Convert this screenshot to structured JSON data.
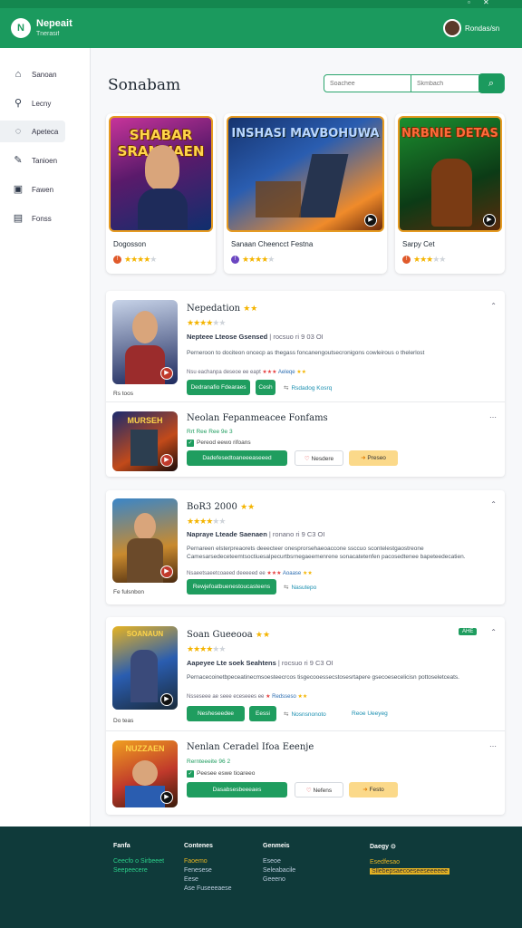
{
  "window": {
    "min": "▫",
    "close": "✕"
  },
  "header": {
    "logo": "N",
    "brand": "Nepeait",
    "brand_sub": "Tnerasif",
    "user_name": "Rondas/sn"
  },
  "sidebar": {
    "items": [
      {
        "label": "Sanoan",
        "icon": "home-icon"
      },
      {
        "label": "Lecny",
        "icon": "link-icon"
      },
      {
        "label": "Apeteca",
        "icon": "shield-icon"
      },
      {
        "label": "Tanioen",
        "icon": "pen-icon"
      },
      {
        "label": "Fawen",
        "icon": "bookmark-icon"
      },
      {
        "label": "Fonss",
        "icon": "document-icon"
      }
    ]
  },
  "main": {
    "title": "Sonabam",
    "search": {
      "placeholder1": "Soachee",
      "placeholder2": "Skmbach"
    }
  },
  "featured": [
    {
      "art": "SHABAR SRAMHAEN",
      "name": "Dogosson",
      "rating": 4,
      "badge": "#e05a2b"
    },
    {
      "art": "INSHASI MAVBOHUWA",
      "name": "Sanaan Cheencct Festna",
      "rating": 4,
      "badge": "#6b46c1"
    },
    {
      "art": "NRBNIE DETAS",
      "name": "Sarpy Cet",
      "rating": 3,
      "badge": "#e05a2b"
    }
  ],
  "games": [
    {
      "title": "Nepedation",
      "subtitle": "Nepteee Lteose Gsensed",
      "sub_meta": "| rocsuo ri 9 03 OI",
      "rating": 4,
      "desc": "Perneroon to dociteon oncecp as thegass foncanengoutsecronigons cowleirous o thelerlost",
      "meta": "Nsu eachanpa deseoe ee eapt",
      "meta_a": "Aeleqe",
      "side": "Rs toos",
      "btn1": "Dedranafio Fdearaes",
      "btn2": "Cesh",
      "link": "Rsdadog Kosrq"
    },
    {
      "title": "Neolan Fepanmeacee Fonfams",
      "green": "Rrt Ree Ree 9e 3",
      "sub2": "Pereod eewo rifoans",
      "btn1": "Dadefesedtoaneeeaseeed",
      "btn2": "Nesdere",
      "btn3": "Preseo"
    },
    {
      "title": "BoR3 2000",
      "subtitle": "Napraye Lteade Saenaen",
      "sub_meta": "| ronano ri 9 C3 OI",
      "rating": 4,
      "desc": "Pernareen elsterpreaorets deeecteer onesprorsehaeoaccone ssccuo scontelestgaostreone Camesarsedeceteemtsoctiuesalpecurtbsrnegaeemenrene sonacatetenfen pacosedtenee bapeteedecatien.",
      "meta": "Nsaeetsaeetcoaeed deeeeed ee",
      "meta_a": "Aoaase",
      "side": "Fe fulsnbon",
      "btn1": "Rewjefoatbuenestoucasteens",
      "link": "Nasutepo"
    },
    {
      "title": "Soan Gueeooa",
      "subtitle": "Aapeyee Lte soek Seahtens",
      "sub_meta": "| rocsuo ri 9 C3 OI",
      "rating": 4,
      "desc": "Pernacecoinetbpeceatinecmsoesteecrcos tisgecooessecstosesrtapere gsecoesecelicisn pottoseletceats.",
      "meta": "Nsseseee ae seee eceseees ee",
      "meta_a": "Redsseso",
      "side": "Do teas",
      "btn1": "Nesheseedee",
      "btn2": "Eessi",
      "link": "Nosnsnonoto",
      "link2": "Reoe Ueeyeg",
      "badge": "AHE"
    },
    {
      "title": "Nenlan Ceradel Ifoa Eeenje",
      "green": "Rernteeeite 96 2",
      "sub2": "Peesee eswe tioareeo",
      "btn1": "Dasabsesbeeeaes",
      "btn2": "Nefens",
      "btn3": "Festo"
    }
  ],
  "footer": {
    "cols": [
      {
        "head": "Fanfa",
        "items": [
          "Ceecfo o Sirbeeet",
          "Seepeecere"
        ]
      },
      {
        "head": "Contenes",
        "items": [
          "Faoemo",
          "Fenesese",
          "Eese",
          "Ase Fuseeeaese"
        ]
      },
      {
        "head": "Genmeis",
        "items": [
          "Eseoe",
          "Seleabacile",
          "Geeeno"
        ]
      },
      {
        "head": "Daegy",
        "items": [
          "Esedfesao",
          "Sllebepsaecoeseeseeeeee"
        ]
      }
    ]
  },
  "colors": {
    "brand": "#1b9a5e",
    "footer": "#0f3a3a",
    "star": "#f4b400"
  }
}
